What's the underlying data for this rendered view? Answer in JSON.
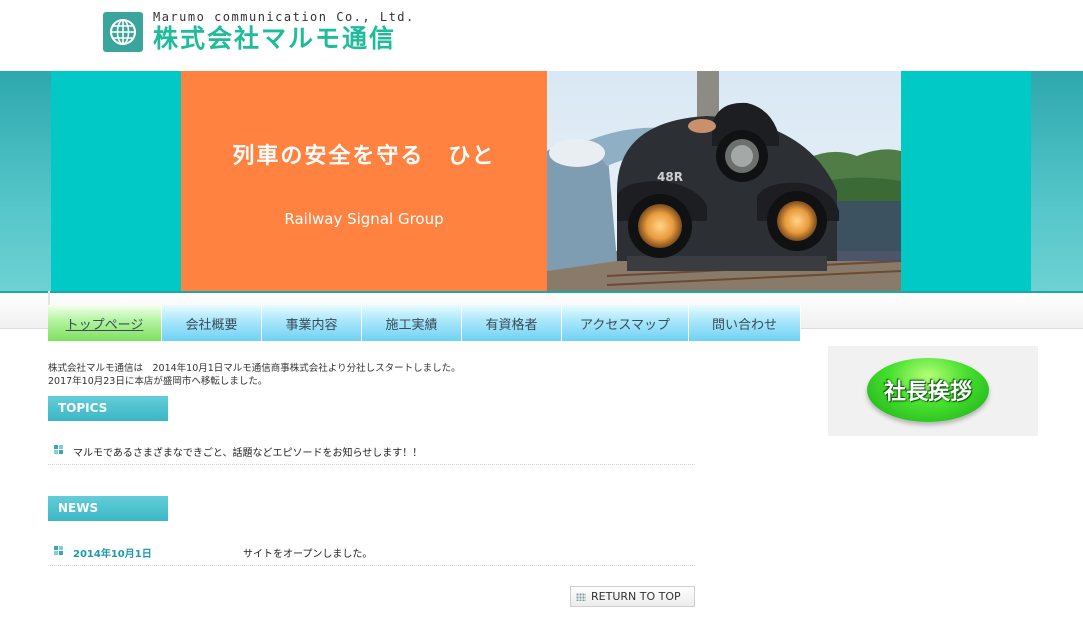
{
  "header": {
    "company_en": "Marumo communication Co., Ltd.",
    "company_jp": "株式会社マルモ通信"
  },
  "banner": {
    "title": "列車の安全を守る　ひと",
    "subtitle": "Railway Signal Group"
  },
  "nav": {
    "items": [
      {
        "label": "トップページ",
        "active": true
      },
      {
        "label": "会社概要"
      },
      {
        "label": "事業内容"
      },
      {
        "label": "施工実績"
      },
      {
        "label": "有資格者"
      },
      {
        "label": "アクセスマップ"
      },
      {
        "label": "問い合わせ"
      }
    ]
  },
  "intro": {
    "line1": "株式会社マルモ通信は　2014年10月1日マルモ通信商事株式会社より分社しスタートしました。",
    "line2": "2017年10月23日に本店が盛岡市へ移転しました。"
  },
  "topics": {
    "label": "TOPICS",
    "items": [
      {
        "text": "マルモであるさまざまなできごと、話題などエピソードをお知らせします！！"
      }
    ]
  },
  "news": {
    "label": "NEWS",
    "items": [
      {
        "date": "2014年10月1日",
        "text": "サイトをオープンしました。"
      }
    ]
  },
  "return_top": "RETURN TO TOP",
  "side": {
    "greeting_button": "社長挨拶"
  },
  "colors": {
    "teal": "#00c9c6",
    "orange": "#ff8241",
    "logo_green": "#1fbc9a",
    "nav_blue": "#6fd2f4",
    "nav_active_green": "#7fe05e"
  }
}
